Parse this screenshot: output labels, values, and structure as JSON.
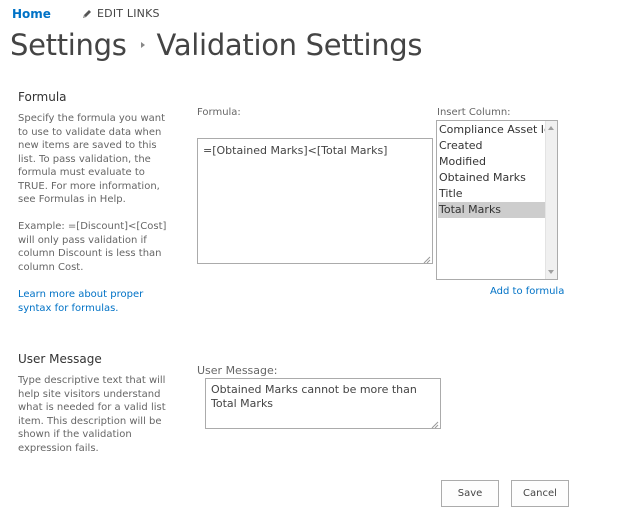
{
  "nav": {
    "home": "Home",
    "edit_links": "EDIT LINKS"
  },
  "title": {
    "parent": "Settings",
    "current": "Validation Settings"
  },
  "formula_section": {
    "heading": "Formula",
    "description": "Specify the formula you want to use to validate data when new items are saved to this list. To pass validation, the formula must evaluate to TRUE. For more information, see Formulas in Help.",
    "example": "Example: =[Discount]<[Cost] will only pass validation if column Discount is less than column Cost.",
    "learn_more": "Learn more about proper syntax for formulas.",
    "formula_label": "Formula:",
    "formula_value": "=[Obtained Marks]<[Total Marks]",
    "insert_column_label": "Insert Column:",
    "columns": [
      "Compliance Asset Id",
      "Created",
      "Modified",
      "Obtained Marks",
      "Title",
      "Total Marks"
    ],
    "selected_column": "Total Marks",
    "add_to_formula": "Add to formula"
  },
  "message_section": {
    "heading": "User Message",
    "description": "Type descriptive text that will help site visitors understand what is needed for a valid list item. This description will be shown if the validation expression fails.",
    "label": "User Message:",
    "value": "Obtained Marks cannot be more than Total Marks"
  },
  "buttons": {
    "save": "Save",
    "cancel": "Cancel"
  },
  "icons": {
    "edit": "pencil-icon",
    "breadcrumb_separator": "caret-right-icon",
    "resize": "resize-grip-icon",
    "scroll_up": "scroll-up-arrow-icon",
    "scroll_down": "scroll-down-arrow-icon"
  },
  "colors": {
    "link": "#0072c6",
    "selected_item": "#cdcdcd",
    "text": "#444444"
  }
}
